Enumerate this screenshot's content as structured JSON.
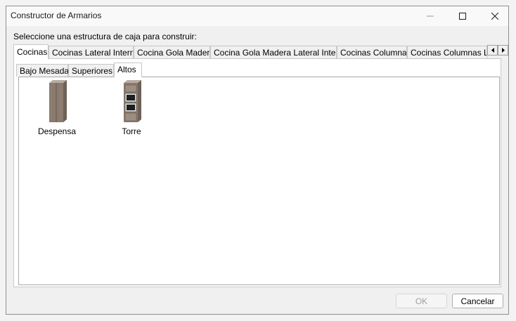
{
  "window": {
    "title": "Constructor de Armarios"
  },
  "instruction": "Seleccione una estructura de caja para construir:",
  "tabs": [
    {
      "label": "Cocinas",
      "active": true
    },
    {
      "label": "Cocinas Lateral Interna"
    },
    {
      "label": "Cocina Gola Madera"
    },
    {
      "label": "Cocina Gola Madera Lateral Interna"
    },
    {
      "label": "Cocinas Columnas"
    },
    {
      "label": "Cocinas Columnas La"
    }
  ],
  "subtabs": [
    {
      "label": "Bajo Mesada"
    },
    {
      "label": "Superiores"
    },
    {
      "label": "Altos",
      "active": true
    }
  ],
  "items": [
    {
      "label": "Despensa",
      "icon": "pantry-cabinet-icon"
    },
    {
      "label": "Torre",
      "icon": "oven-tower-cabinet-icon"
    }
  ],
  "buttons": {
    "ok": "OK",
    "cancel": "Cancelar"
  },
  "colors": {
    "wood": "#8a7b6e",
    "wood_dark": "#6e6257",
    "appliance": "#1e1e1e"
  }
}
